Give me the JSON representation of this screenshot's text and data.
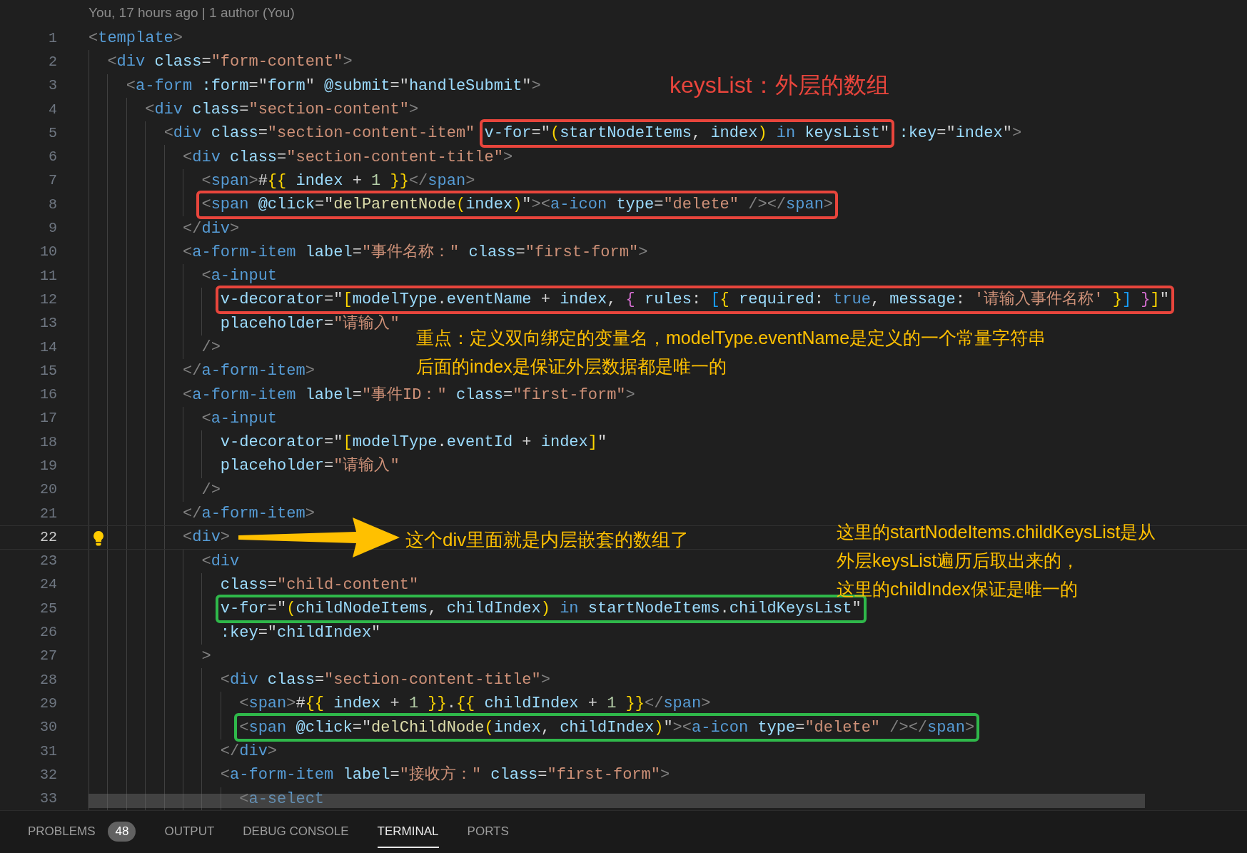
{
  "blame": "You, 17 hours ago | 1 author (You)",
  "lines": [
    {
      "number": "1",
      "current": false,
      "text": "<template>"
    },
    {
      "number": "2",
      "current": false,
      "text": "  <div class=\"form-content\">"
    },
    {
      "number": "3",
      "current": false,
      "text": "    <a-form :form=\"form\" @submit=\"handleSubmit\">"
    },
    {
      "number": "4",
      "current": false,
      "text": "      <div class=\"section-content\">"
    },
    {
      "number": "5",
      "current": false,
      "parts": [
        {
          "text": "        <div class=\"section-content-item\" ",
          "boxed": false
        },
        {
          "text": "v-for=\"(startNodeItems, index) in keysList\"",
          "boxed": true,
          "color": "#e8453c"
        },
        {
          "text": " :key=\"index\">",
          "boxed": false
        }
      ]
    },
    {
      "number": "6",
      "current": false,
      "text": "          <div class=\"section-content-title\">"
    },
    {
      "number": "7",
      "current": false,
      "text": "            <span>#{{ index + 1 }}</span>"
    },
    {
      "number": "8",
      "current": false,
      "parts": [
        {
          "text": "            <span @click=\"delParentNode(index)\"><a-icon type=\"delete\" /></span>",
          "boxed": true,
          "color": "#e8453c"
        }
      ]
    },
    {
      "number": "9",
      "current": false,
      "text": "          </div>"
    },
    {
      "number": "10",
      "current": false,
      "text": "          <a-form-item label=\"事件名称：\" class=\"first-form\">"
    },
    {
      "number": "11",
      "current": false,
      "text": "            <a-input"
    },
    {
      "number": "12",
      "current": false,
      "parts": [
        {
          "text": "              v-decorator=\"[modelType.eventName + index, { rules: [{ required: true, message: '请输入事件名称' }] }]\"",
          "boxed": true,
          "color": "#e8453c"
        }
      ]
    },
    {
      "number": "13",
      "current": false,
      "text": "              placeholder=\"请输入\""
    },
    {
      "number": "14",
      "current": false,
      "text": "            />"
    },
    {
      "number": "15",
      "current": false,
      "text": "          </a-form-item>"
    },
    {
      "number": "16",
      "current": false,
      "text": "          <a-form-item label=\"事件ID：\" class=\"first-form\">"
    },
    {
      "number": "17",
      "current": false,
      "text": "            <a-input"
    },
    {
      "number": "18",
      "current": false,
      "text": "              v-decorator=\"[modelType.eventId + index]\""
    },
    {
      "number": "19",
      "current": false,
      "text": "              placeholder=\"请输入\""
    },
    {
      "number": "20",
      "current": false,
      "text": "            />"
    },
    {
      "number": "21",
      "current": false,
      "text": "          </a-form-item>"
    },
    {
      "number": "22",
      "current": true,
      "text": "          <div>"
    },
    {
      "number": "23",
      "current": false,
      "text": "            <div"
    },
    {
      "number": "24",
      "current": false,
      "text": "              class=\"child-content\""
    },
    {
      "number": "25",
      "current": false,
      "parts": [
        {
          "text": "              v-for=\"(childNodeItems, childIndex) in startNodeItems.childKeysList\"",
          "boxed": true,
          "color": "#2fb84a"
        }
      ]
    },
    {
      "number": "26",
      "current": false,
      "text": "              :key=\"childIndex\""
    },
    {
      "number": "27",
      "current": false,
      "text": "            >"
    },
    {
      "number": "28",
      "current": false,
      "text": "              <div class=\"section-content-title\">"
    },
    {
      "number": "29",
      "current": false,
      "text": "                <span>#{{ index + 1 }}.{{ childIndex + 1 }}</span>"
    },
    {
      "number": "30",
      "current": false,
      "parts": [
        {
          "text": "                <span @click=\"delChildNode(index, childIndex)\"><a-icon type=\"delete\" /></span>",
          "boxed": true,
          "color": "#2fb84a"
        }
      ]
    },
    {
      "number": "31",
      "current": false,
      "text": "              </div>"
    },
    {
      "number": "32",
      "current": false,
      "text": "              <a-form-item label=\"接收方：\" class=\"first-form\">"
    },
    {
      "number": "33",
      "current": false,
      "text": "                <a-select"
    }
  ],
  "notes": {
    "keys_list": "keysList：外层的数组",
    "key_point": [
      "重点：定义双向绑定的变量名，modelType.eventName是定义的一个常量字符串",
      "后面的index是保证外层数据都是唯一的"
    ],
    "inner_div": "这个div里面就是内层嵌套的数组了",
    "child_list": [
      "这里的startNodeItems.childKeysList是从",
      "外层keysList遍历后取出来的，",
      "这里的childIndex保证是唯一的"
    ]
  },
  "panel_tabs": [
    {
      "label": "PROBLEMS",
      "badge": "48",
      "selected": false
    },
    {
      "label": "OUTPUT",
      "selected": false
    },
    {
      "label": "DEBUG CONSOLE",
      "selected": false
    },
    {
      "label": "TERMINAL",
      "selected": true
    },
    {
      "label": "PORTS",
      "selected": false
    }
  ]
}
